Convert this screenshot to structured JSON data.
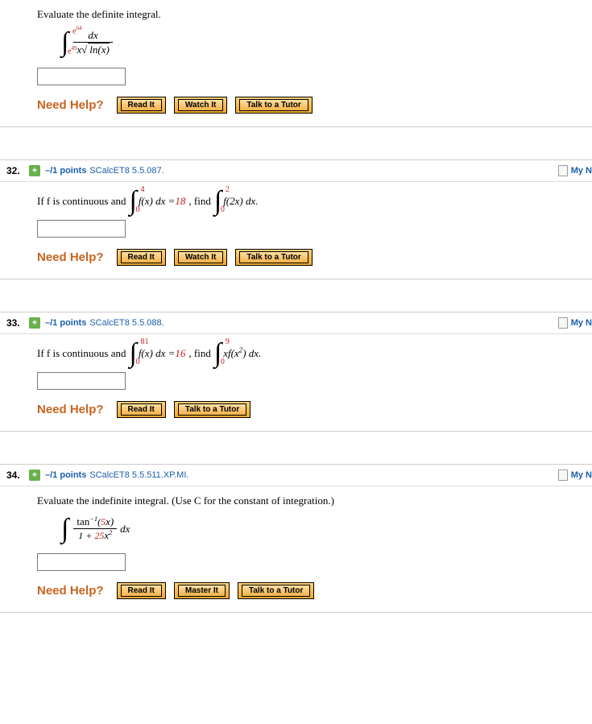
{
  "labels": {
    "need_help": "Need Help?",
    "read_it": "Read It",
    "watch_it": "Watch It",
    "master_it": "Master It",
    "talk_tutor": "Talk to a Tutor",
    "my_notes": "My N"
  },
  "q31": {
    "prompt": "Evaluate the definite integral.",
    "int_upper_base": "e",
    "int_upper_exp": "64",
    "int_lower_base": "e",
    "int_lower_exp": "49",
    "numerator": "dx",
    "den_x": "x",
    "den_inside": "ln(x)"
  },
  "q32": {
    "num": "32.",
    "points": "–/1 points",
    "source": "SCalcET8 5.5.087.",
    "text_pre": "If f is continuous and",
    "int1_upper": "4",
    "int1_lower": "0",
    "int1_body": "f(x) dx = ",
    "int1_val": "18",
    "mid": ",  find",
    "int2_upper": "2",
    "int2_lower": "0",
    "int2_body": "f(2x) dx."
  },
  "q33": {
    "num": "33.",
    "points": "–/1 points",
    "source": "SCalcET8 5.5.088.",
    "text_pre": "If f is continuous and",
    "int1_upper": "81",
    "int1_lower": "0",
    "int1_body": "f(x) dx = ",
    "int1_val": "16",
    "mid": ",  find",
    "int2_upper": "9",
    "int2_lower": "0",
    "int2_body_pre": "xf(x",
    "int2_body_exp": "2",
    "int2_body_post": ") dx."
  },
  "q34": {
    "num": "34.",
    "points": "–/1 points",
    "source": "SCalcET8 5.5.511.XP.MI.",
    "prompt": "Evaluate the indefinite integral. (Use C for the constant of integration.)",
    "num_tan": "tan",
    "num_exp": "−1",
    "num_arg_a": "(",
    "num_arg_b": "5",
    "num_arg_c": "x)",
    "den_a": "1 + ",
    "den_b": "25",
    "den_c": "x",
    "den_exp": "2",
    "dx": "dx"
  }
}
